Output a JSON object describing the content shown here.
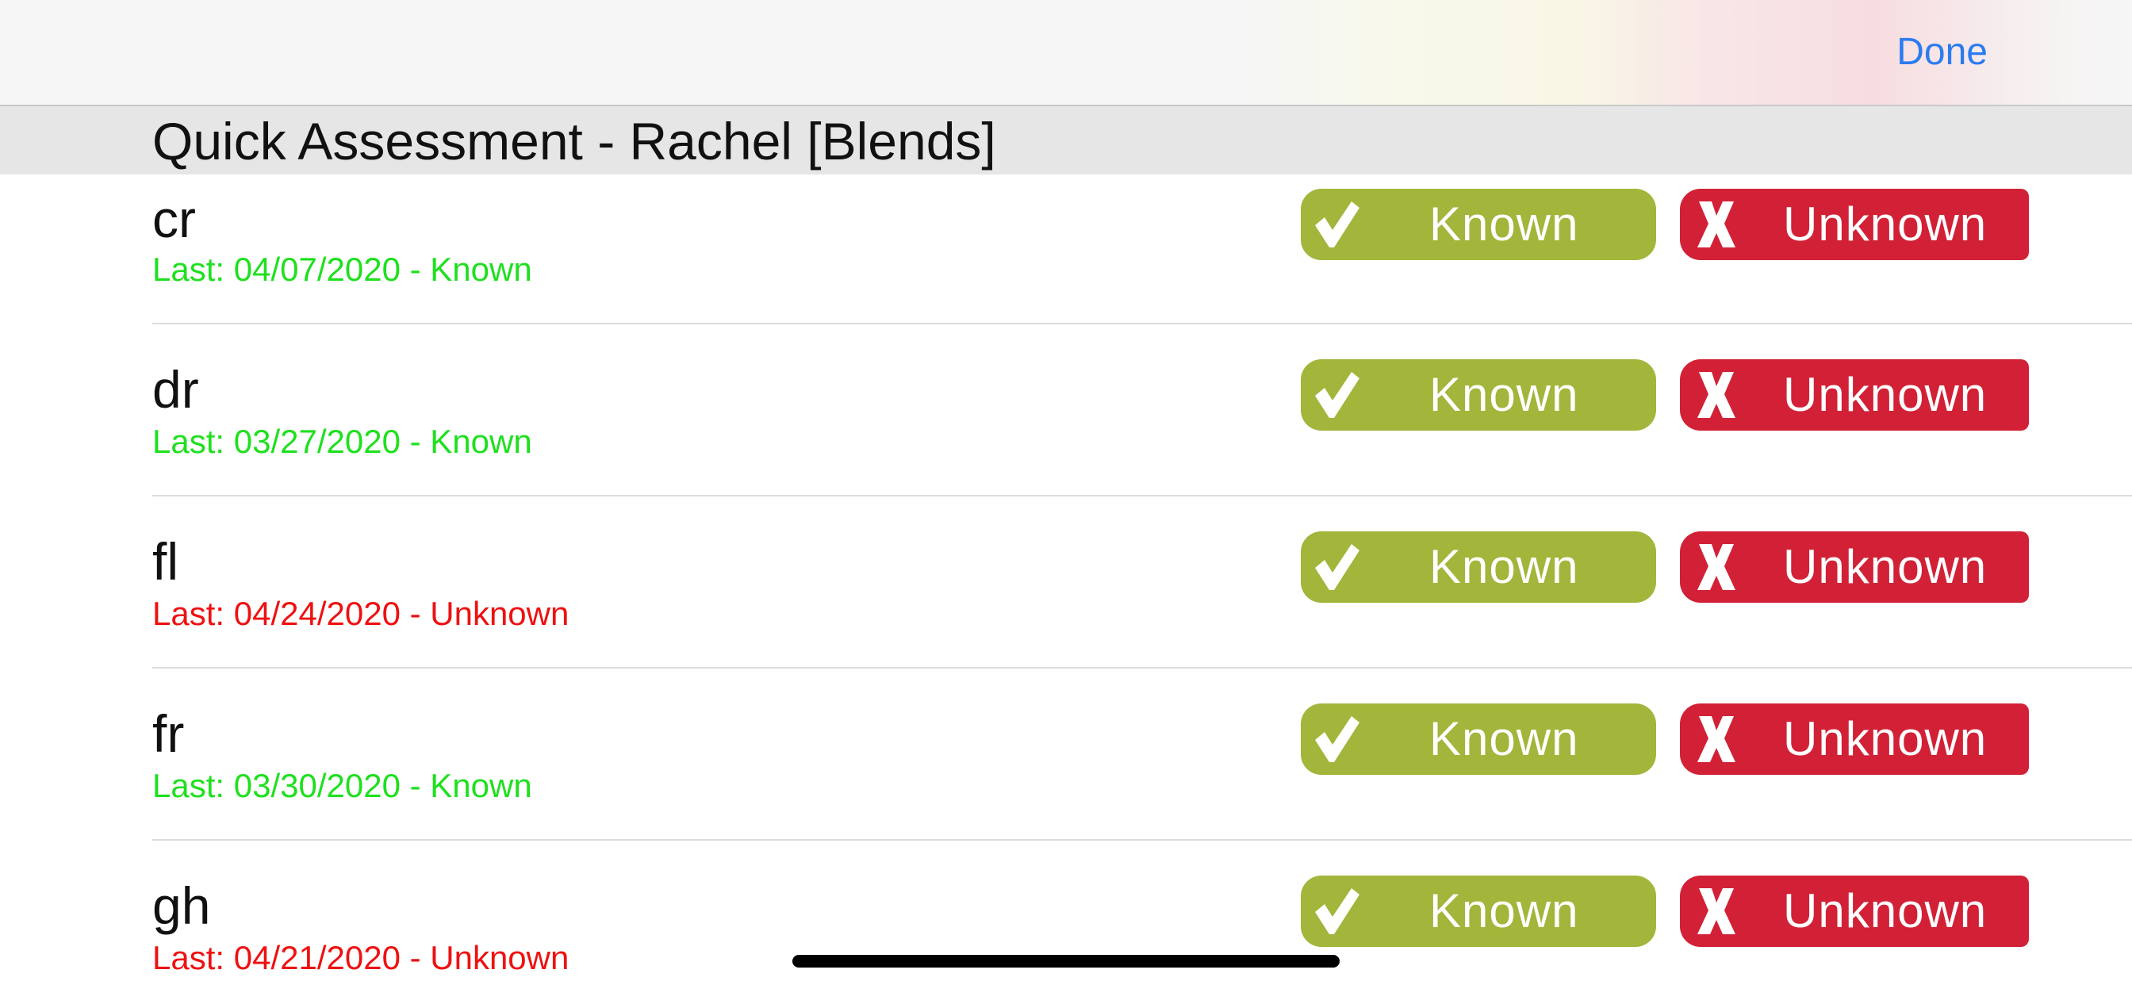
{
  "navbar": {
    "done_label": "Done"
  },
  "header": {
    "title": "Quick Assessment - Rachel [Blends]"
  },
  "buttons": {
    "known_label": "Known",
    "unknown_label": "Unknown",
    "known_icon": "checkmark-icon",
    "unknown_icon": "x-icon"
  },
  "colors": {
    "accent": "#2b7cf0",
    "known_button": "#a3b53a",
    "unknown_button": "#d22136",
    "status_known": "#1ee01e",
    "status_unknown": "#ee1111"
  },
  "items": [
    {
      "label": "cr",
      "last": "Last: 04/07/2020 - Known",
      "status": "known"
    },
    {
      "label": "dr",
      "last": "Last: 03/27/2020 - Known",
      "status": "known"
    },
    {
      "label": "fl",
      "last": "Last: 04/24/2020 - Unknown",
      "status": "unknown"
    },
    {
      "label": "fr",
      "last": "Last: 03/30/2020 - Known",
      "status": "known"
    },
    {
      "label": "gh",
      "last": "Last: 04/21/2020 - Unknown",
      "status": "unknown"
    }
  ]
}
